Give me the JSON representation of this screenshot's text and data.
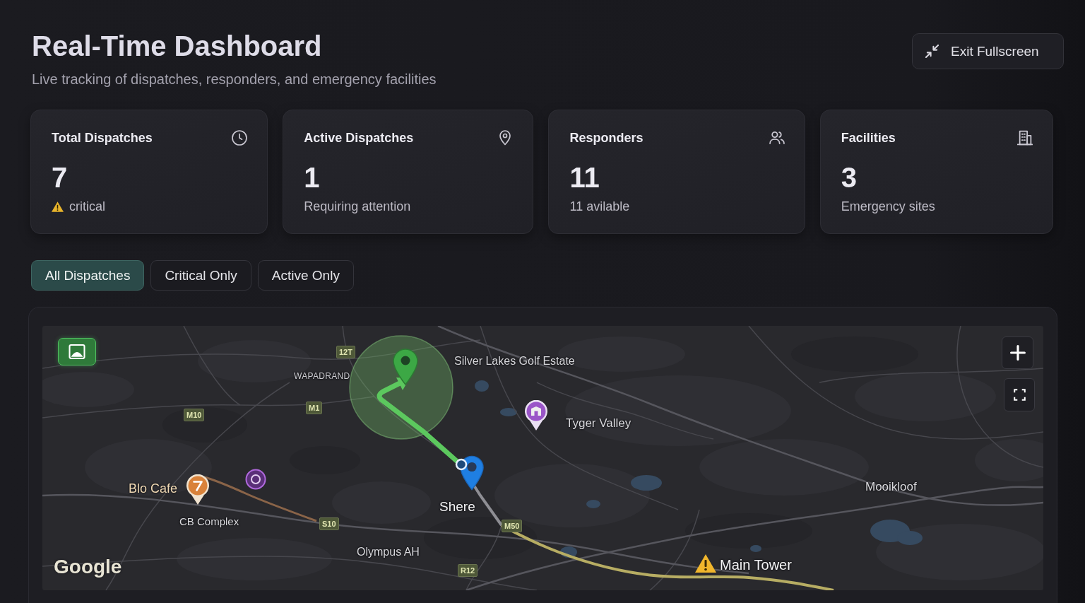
{
  "header": {
    "title": "Real-Time Dashboard",
    "subtitle": "Live tracking of dispatches, responders, and emergency facilities",
    "exit_button": {
      "label": "Exit Fullscreen"
    }
  },
  "stats": [
    {
      "title": "Total Dispatches",
      "value": "7",
      "note": "critical",
      "warning": true
    },
    {
      "title": "Active Dispatches",
      "value": "1",
      "note": "Requiring attention",
      "warning": false
    },
    {
      "title": "Responders",
      "value": "11",
      "note": "11 avilable",
      "warning": false
    },
    {
      "title": "Facilities",
      "value": "3",
      "note": "Emergency sites",
      "warning": false
    }
  ],
  "filters": [
    {
      "label": "All Dispatches",
      "selected": true
    },
    {
      "label": "Critical Only",
      "selected": false
    },
    {
      "label": "Active Only",
      "selected": false
    }
  ],
  "map": {
    "layer_button": {
      "on": true
    },
    "labels": [
      {
        "text": "12T",
        "kind": "road"
      },
      {
        "text": "WAPADRAND",
        "kind": "area"
      },
      {
        "text": "Silver Lakes Golf Estate",
        "kind": "place"
      },
      {
        "text": "M10",
        "kind": "road"
      },
      {
        "text": "M1",
        "kind": "road"
      },
      {
        "text": "Tyger Valley",
        "kind": "place"
      },
      {
        "text": "Blo Cafe",
        "kind": "poi"
      },
      {
        "text": "Mooikloof",
        "kind": "place"
      },
      {
        "text": "Shere",
        "kind": "town"
      },
      {
        "text": "CB Complex",
        "kind": "place"
      },
      {
        "text": "S10",
        "kind": "road"
      },
      {
        "text": "M50",
        "kind": "road"
      },
      {
        "text": "Olympus AH",
        "kind": "place"
      },
      {
        "text": "Main Tower",
        "kind": "town"
      },
      {
        "text": "R12",
        "kind": "road"
      }
    ],
    "attribution": "Google"
  }
}
